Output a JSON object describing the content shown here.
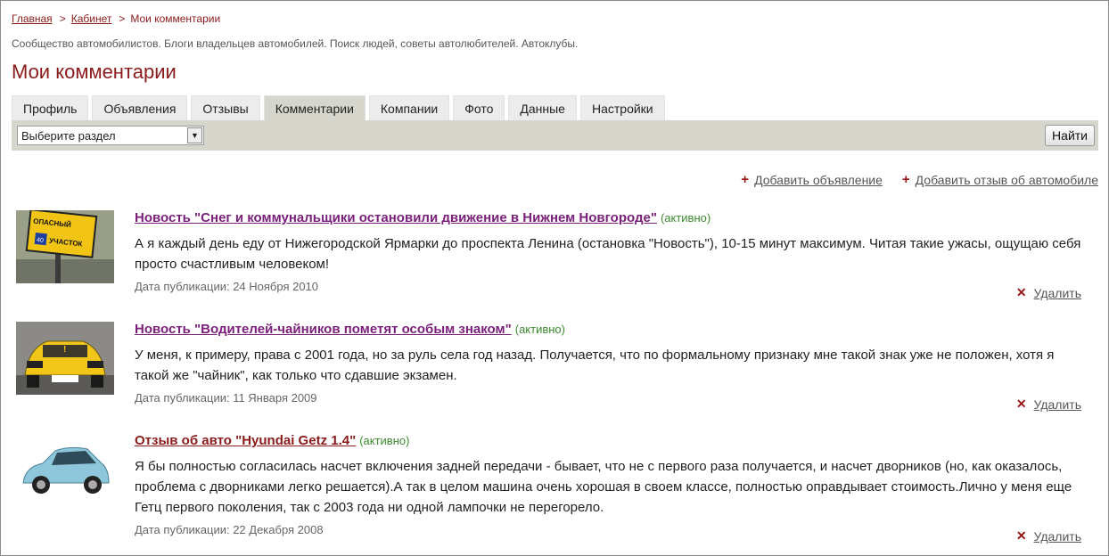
{
  "breadcrumb": {
    "home": "Главная",
    "cabinet": "Кабинет",
    "current": "Мои комментарии",
    "separator": ">"
  },
  "tagline": "Сообщество автомобилистов. Блоги владельцев автомобилей. Поиск людей, советы автолюбителей. Автоклубы.",
  "page_title": "Мои комментарии",
  "tabs": [
    "Профиль",
    "Объявления",
    "Отзывы",
    "Комментарии",
    "Компании",
    "Фото",
    "Данные",
    "Настройки"
  ],
  "active_tab": "Комментарии",
  "filter": {
    "select_value": "Выберите раздел",
    "find_label": "Найти"
  },
  "actions": {
    "add_ad": "Добавить объявление",
    "add_review": "Добавить отзыв об автомобиле"
  },
  "comments": [
    {
      "title": "Новость \"Снег и коммунальщики остановили движение в Нижнем Новгороде\"",
      "status": "(активно)",
      "text": "А я каждый день еду от Нижегородской Ярмарки до проспекта Ленина (остановка \"Новость\"), 10-15 минут максимум. Читая такие ужасы, ощущаю себя просто счастливым человеком!",
      "date": "Дата публикации: 24 Ноября 2010",
      "delete": "Удалить",
      "thumb": "road-sign-thumbnail"
    },
    {
      "title": "Новость \"Водителей-чайников пометят особым знаком\"",
      "status": "(активно)",
      "text": "У меня, к примеру, права с 2001 года, но за руль села год назад. Получается, что по формальному признаку мне такой знак уже не положен, хотя я такой же \"чайник\", как только что сдавшие экзамен.",
      "date": "Дата публикации: 11 Января 2009",
      "delete": "Удалить",
      "thumb": "yellow-car-thumbnail"
    },
    {
      "title": "Отзыв об авто \"Hyundai Getz 1.4\"",
      "status": "(активно)",
      "text": "Я бы полностью согласилась насчет включения задней передачи - бывает, что не с первого раза получается, и насчет дворников (но, как оказалось, проблема с дворниками легко решается).А так в целом машина очень хорошая в своем классе, полностью оправдывает стоимость.Лично у меня еще Гетц первого поколения, так с 2003 года ни одной лампочки не перегорело.",
      "date": "Дата публикации: 22 Декабря 2008",
      "delete": "Удалить",
      "thumb": "blue-hatchback-thumbnail"
    }
  ],
  "colors": {
    "brand": "#8b1a1a",
    "visited_link": "#7a1f7a",
    "status": "#3c8a2e",
    "toolbar": "#d6d6cc"
  }
}
